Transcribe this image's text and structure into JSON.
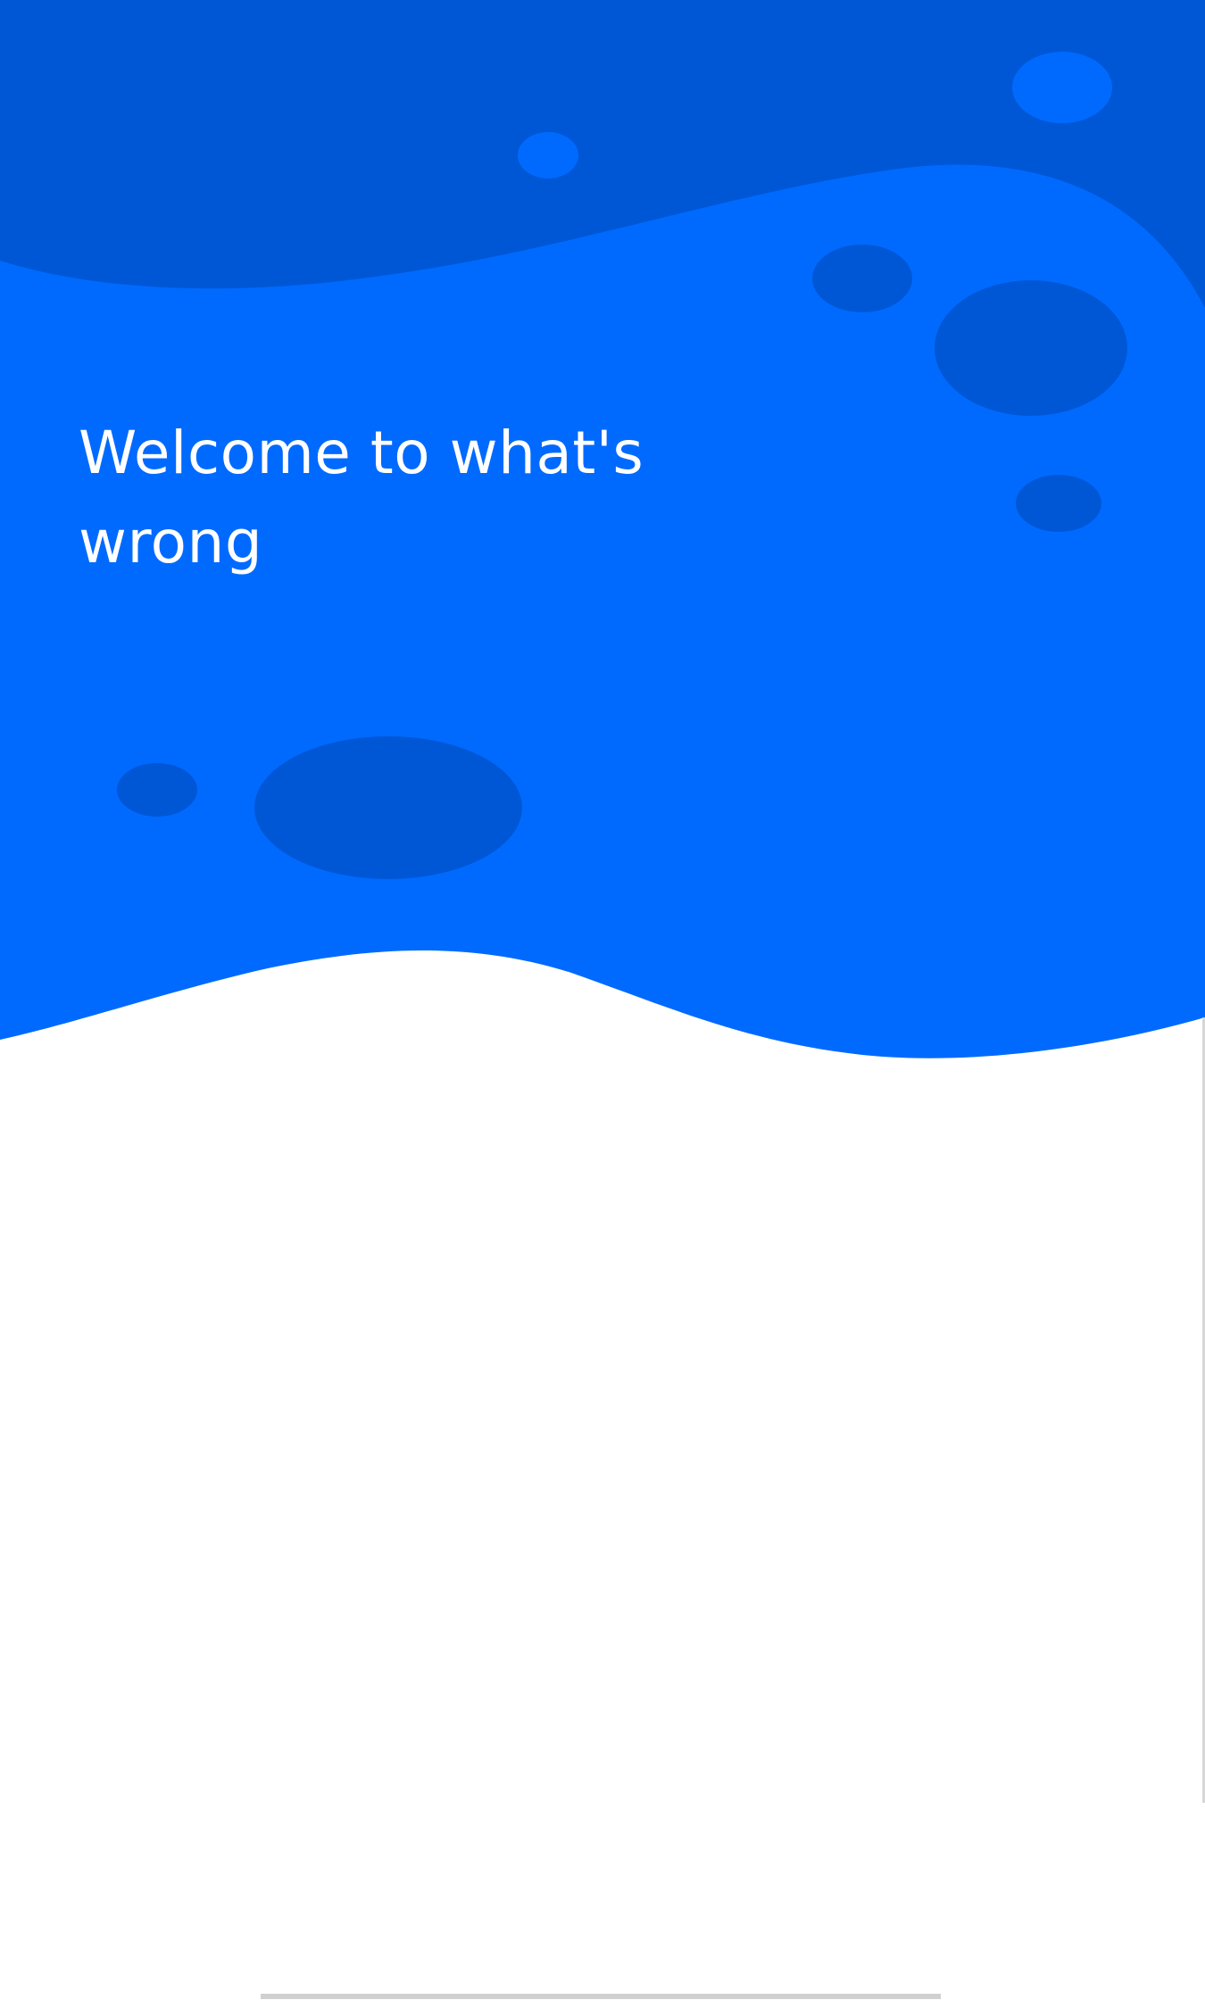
{
  "welcome": {
    "title": "Welcome to what's wrong"
  },
  "colors": {
    "dark_blue": "#0057d6",
    "bright_blue": "#006aff",
    "background": "#ffffff",
    "text": "#ffffff"
  }
}
